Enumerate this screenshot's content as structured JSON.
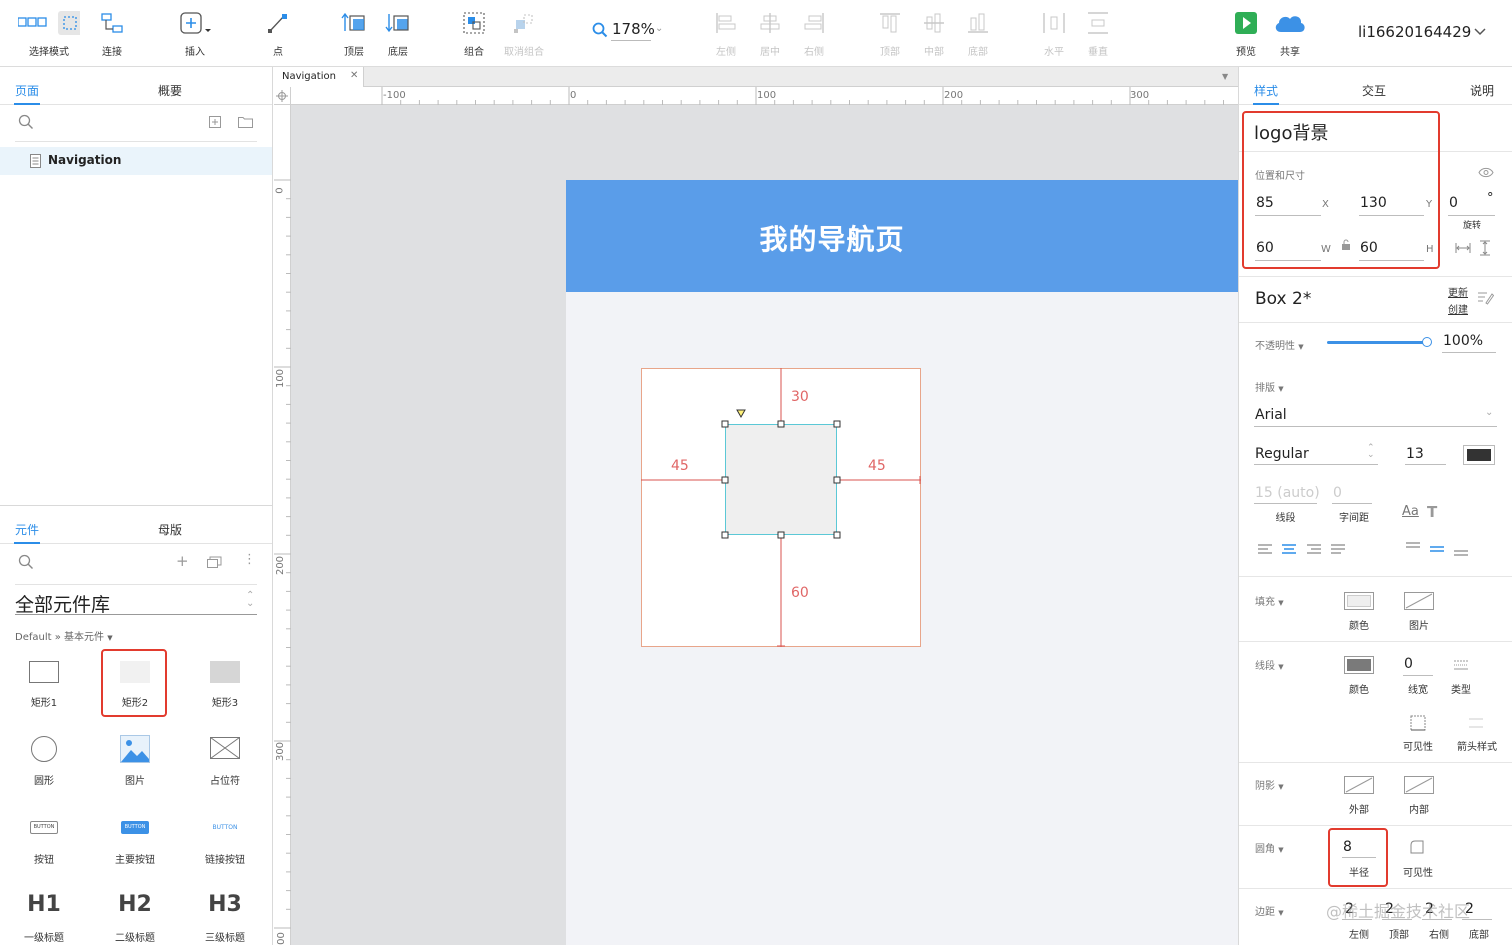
{
  "toolbar": {
    "select_mode": "选择模式",
    "connect": "连接",
    "insert": "插入",
    "point": "点",
    "top_layer": "顶层",
    "bottom_layer": "底层",
    "group": "组合",
    "ungroup": "取消组合",
    "zoom": "178%",
    "align_left": "左侧",
    "align_center": "居中",
    "align_right": "右侧",
    "align_top": "顶部",
    "align_middle": "中部",
    "align_bottom": "底部",
    "distribute_h": "水平",
    "distribute_v": "垂直",
    "preview": "预览",
    "share": "共享",
    "user": "li16620164429"
  },
  "pages_panel": {
    "tab_pages": "页面",
    "tab_outline": "概要",
    "page_name": "Navigation"
  },
  "library_panel": {
    "tab_widgets": "元件",
    "tab_masters": "母版",
    "library_title": "全部元件库",
    "breadcrumb": "Default » 基本元件",
    "items": [
      {
        "label": "矩形1",
        "icon": "rectangle-outline-icon"
      },
      {
        "label": "矩形2",
        "icon": "rectangle-light-fill-icon"
      },
      {
        "label": "矩形3",
        "icon": "rectangle-gray-fill-icon"
      },
      {
        "label": "圆形",
        "icon": "circle-icon"
      },
      {
        "label": "图片",
        "icon": "image-icon"
      },
      {
        "label": "占位符",
        "icon": "placeholder-icon"
      },
      {
        "label": "按钮",
        "icon": "button-icon",
        "badge": "BUTTON"
      },
      {
        "label": "主要按钮",
        "icon": "primary-button-icon",
        "badge": "BUTTON"
      },
      {
        "label": "链接按钮",
        "icon": "link-button-icon",
        "badge": "BUTTON"
      },
      {
        "label": "一级标题",
        "icon": "h1-icon",
        "badge": "H1"
      },
      {
        "label": "二级标题",
        "icon": "h2-icon",
        "badge": "H2"
      },
      {
        "label": "三级标题",
        "icon": "h3-icon",
        "badge": "H3"
      }
    ]
  },
  "canvas": {
    "tab_name": "Navigation",
    "ruler_top": [
      "-100",
      "0",
      "100",
      "200",
      "300"
    ],
    "ruler_left": [
      "0",
      "100",
      "200",
      "300",
      "00"
    ],
    "header_text": "我的导航页",
    "header_color": "#5a9de9",
    "dist_top": "30",
    "dist_left": "45",
    "dist_right": "45",
    "dist_bottom": "60"
  },
  "style_panel": {
    "tab_style": "样式",
    "tab_interact": "交互",
    "tab_notes": "说明",
    "widget_name": "logo背景",
    "pos_size_label": "位置和尺寸",
    "x": "85",
    "x_label": "X",
    "y": "130",
    "y_label": "Y",
    "w": "60",
    "w_label": "W",
    "h": "60",
    "h_label": "H",
    "rotation": "0",
    "rotation_unit": "°",
    "rotation_label": "旋转",
    "style_name": "Box 2*",
    "update": "更新",
    "create": "创建",
    "opacity_label": "不透明性",
    "opacity": "100%",
    "opacity_fraction": 1.0,
    "typography_label": "排版",
    "font": "Arial",
    "font_weight": "Regular",
    "font_size": "13",
    "font_color": "#333333",
    "line_height": "15 (auto)",
    "letter_spacing": "0",
    "line_label": "线段",
    "char_spacing_label": "字间距",
    "fill_label": "填充",
    "fill_color_label": "颜色",
    "fill_image_label": "图片",
    "border_label": "线段",
    "border_color_label": "颜色",
    "border_width": "0",
    "border_width_label": "线宽",
    "border_type_label": "类型",
    "visibility_label": "可见性",
    "arrow_style_label": "箭头样式",
    "shadow_label": "阴影",
    "shadow_outer": "外部",
    "shadow_inner": "内部",
    "radius_label": "圆角",
    "radius": "8",
    "radius_unit_label": "半径",
    "radius_visibility": "可见性",
    "padding_label": "边距",
    "padding_left": "2",
    "padding_top": "2",
    "padding_right": "2",
    "padding_bottom": "2",
    "padding_left_label": "左侧",
    "padding_top_label": "顶部",
    "padding_right_label": "右侧",
    "padding_bottom_label": "底部",
    "watermark": "@稀土掘金技术社区"
  },
  "colors": {
    "accent": "#2b8de8",
    "highlight": "#e23b2e",
    "measure": "#e06666",
    "selection": "#5bc8d6"
  }
}
